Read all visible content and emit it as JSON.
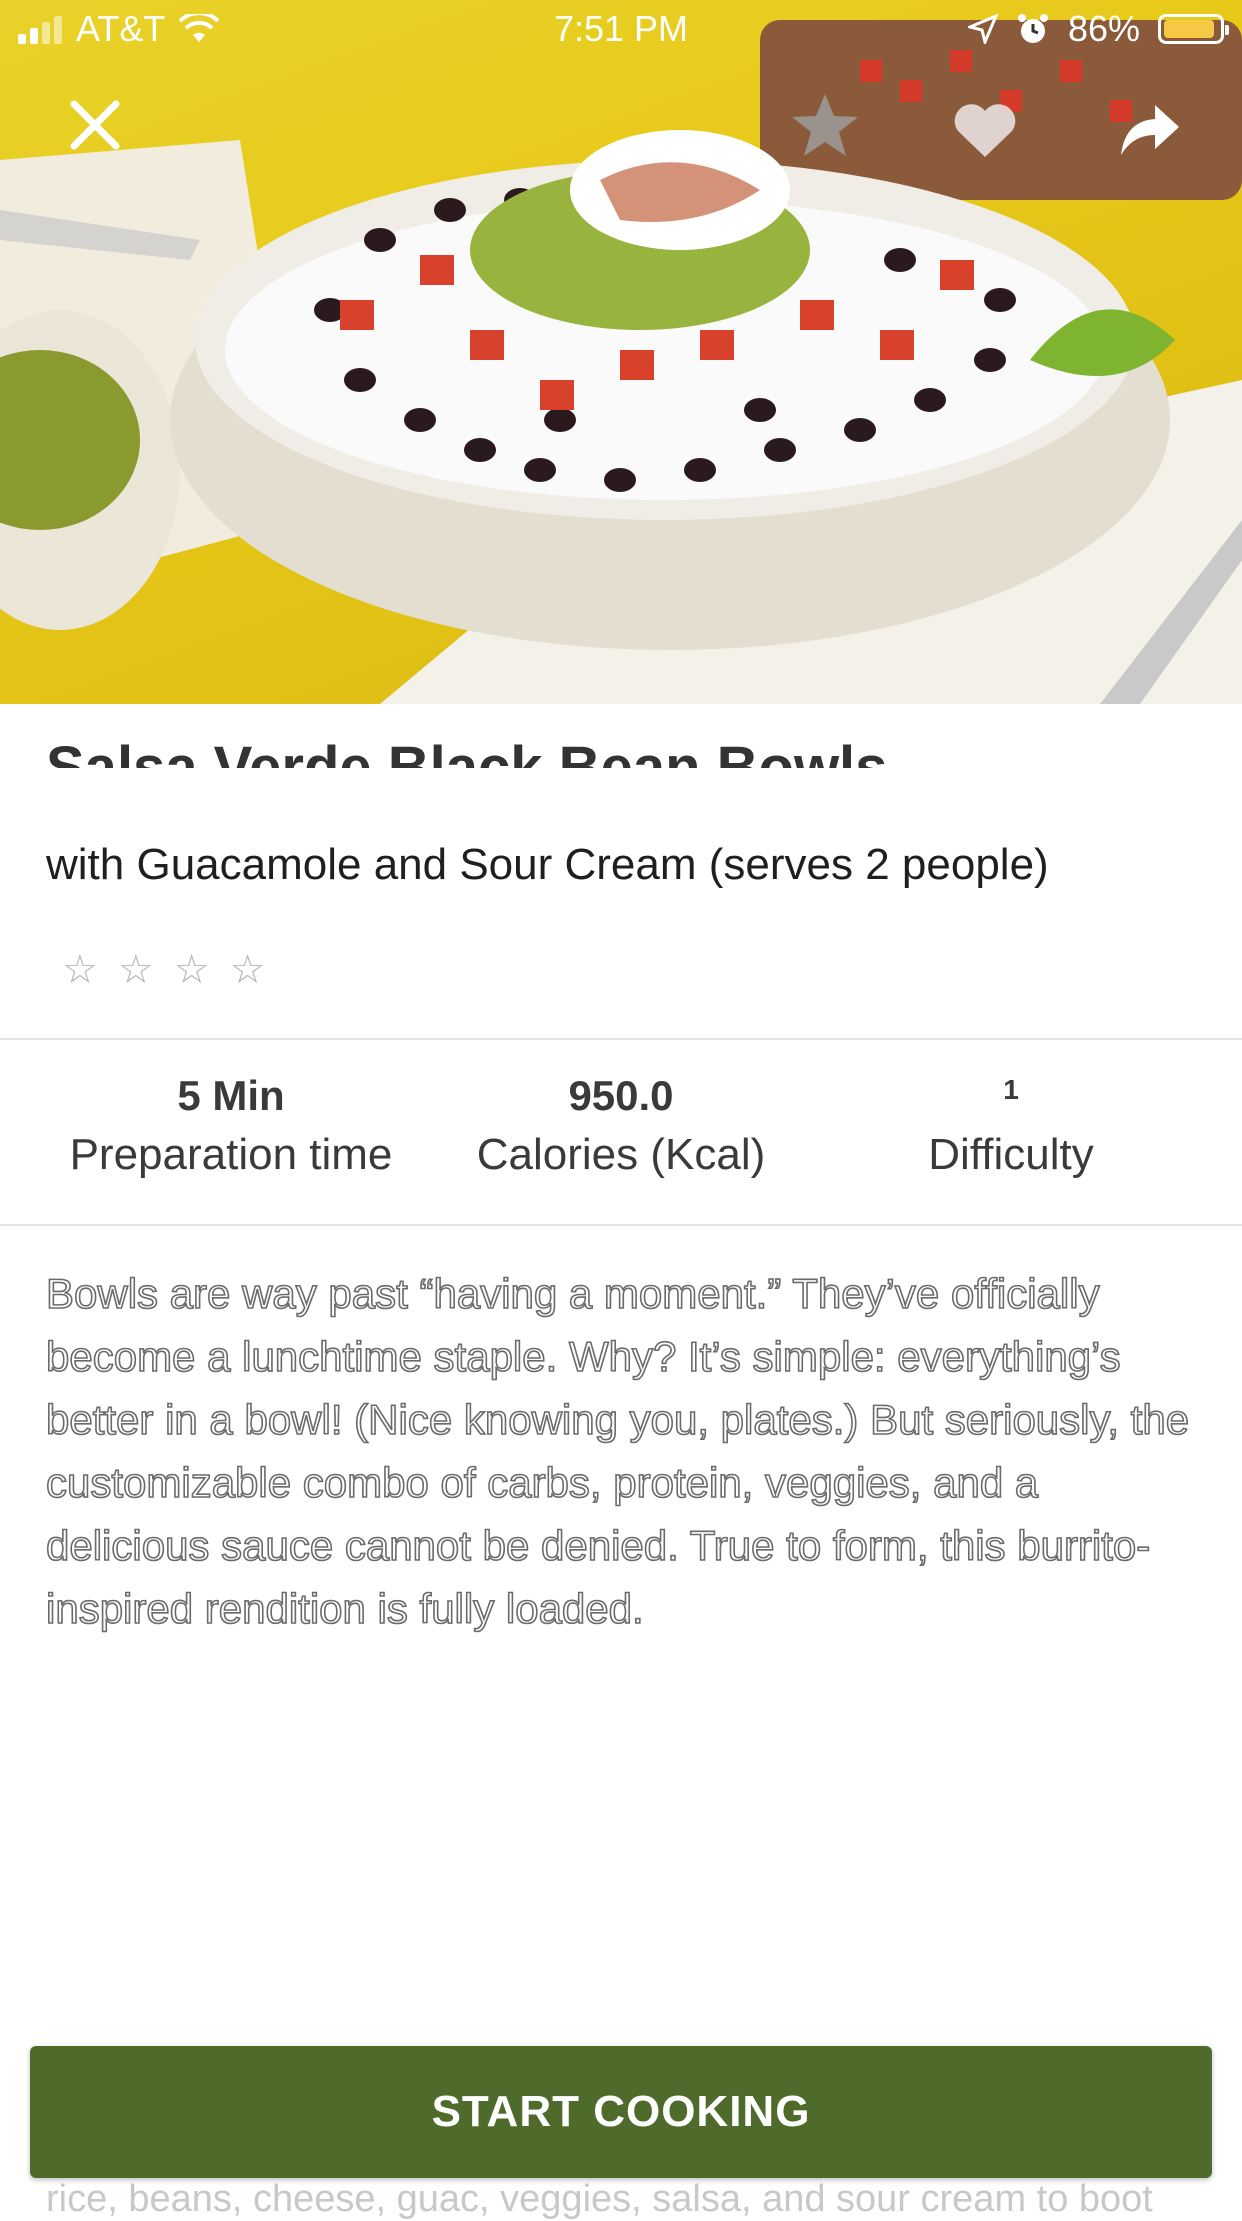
{
  "status_bar": {
    "carrier": "AT&T",
    "time": "7:51 PM",
    "battery": "86%"
  },
  "header": {
    "close_icon": "close-icon",
    "favorite_star_icon": "star-icon",
    "like_icon": "heart-icon",
    "share_icon": "share-icon"
  },
  "recipe": {
    "title": "Salsa Verde Black Bean Bowls",
    "subtitle": "with Guacamole and Sour Cream (serves 2 people)",
    "rating_stars": [
      "☆",
      "☆",
      "☆",
      "☆"
    ],
    "stats": [
      {
        "value": "5 Min",
        "label": "Preparation time"
      },
      {
        "value": "950.0",
        "label": "Calories (Kcal)"
      },
      {
        "value": "1",
        "label": "Difficulty"
      }
    ],
    "description": "Bowls are way past “having a moment.” They’ve officially become a lunchtime staple. Why? It’s simple: everything’s better in a bowl! (Nice knowing you, plates.) But seriously, the customizable combo of carbs, protein, veggies, and a delicious sauce cannot be denied. True to form, this burrito-inspired rendition is fully loaded.",
    "description_continued": "rice, beans, cheese, guac, veggies, salsa, and sour cream to boot"
  },
  "cta": {
    "start_cooking_label": "START COOKING"
  },
  "colors": {
    "cta_background": "#4f6b2c",
    "hero_background": "#e7c919"
  }
}
